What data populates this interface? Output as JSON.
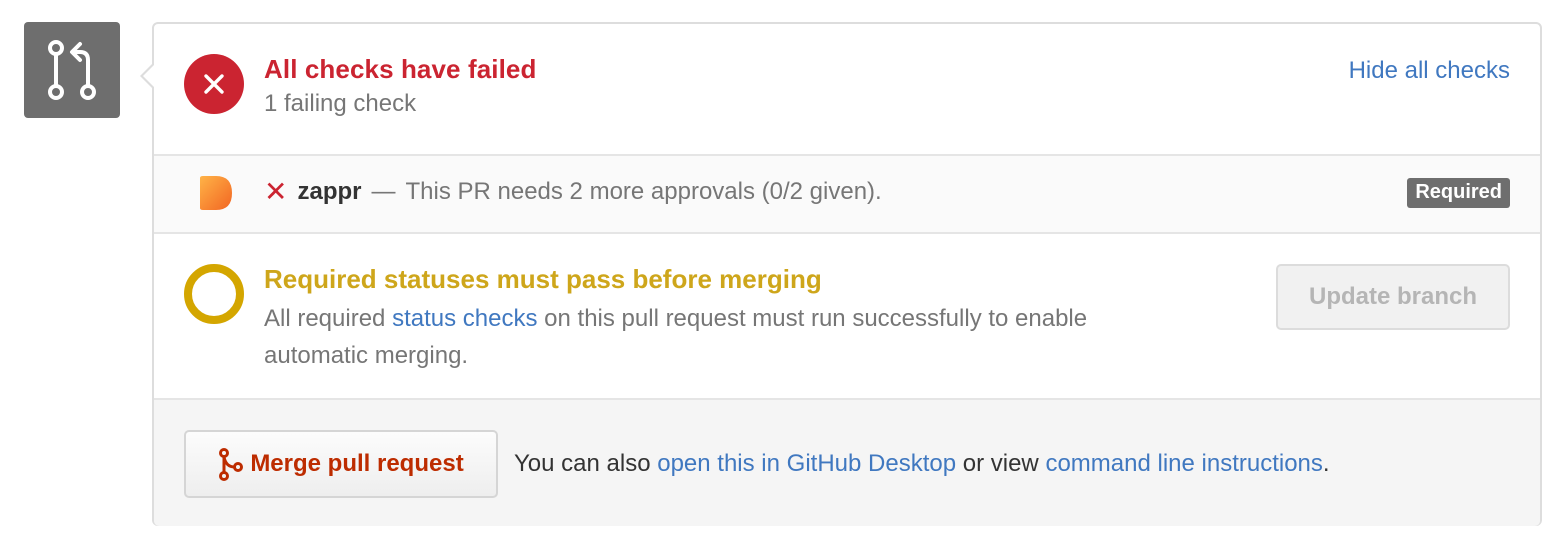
{
  "checks": {
    "title": "All checks have failed",
    "subtitle": "1 failing check",
    "hide_link": "Hide all checks"
  },
  "zappr": {
    "name": "zappr",
    "separator": "—",
    "description": "This PR needs 2 more approvals (0/2 given).",
    "badge": "Required"
  },
  "required": {
    "title": "Required statuses must pass before merging",
    "desc_prefix": "All required",
    "desc_link": "status checks",
    "desc_suffix": "on this pull request must run successfully to enable automatic merging.",
    "update_button": "Update branch"
  },
  "merge": {
    "button": "Merge pull request",
    "text_prefix": "You can also",
    "desktop_link": "open this in GitHub Desktop",
    "text_middle": "or view",
    "cli_link": "command line instructions",
    "text_suffix": "."
  },
  "icons": {
    "pr": "git-pull-request-icon",
    "fail": "x-circle-icon",
    "zappr": "zappr-logo-icon",
    "x": "x-icon",
    "pending": "pending-circle-icon",
    "merge": "git-merge-icon"
  },
  "colors": {
    "failed": "#cb2431",
    "pending": "#d4a600",
    "link": "#4078c0",
    "merge_text": "#bd2c00"
  }
}
